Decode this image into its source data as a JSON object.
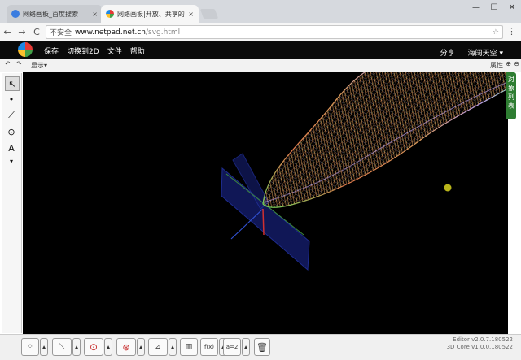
{
  "browser": {
    "tabs": [
      {
        "title": "网络画板_百度搜索",
        "close": "×"
      },
      {
        "title": "网络画板|开放、共享的",
        "close": "×"
      }
    ],
    "window_controls": {
      "minimize": "—",
      "maximize": "☐",
      "close": "✕"
    },
    "back": "←",
    "forward": "→",
    "reload": "C",
    "security_text": "不安全",
    "url_host": "www.netpad.net.cn",
    "url_path": "/svg.html",
    "star": "☆",
    "menu": "⋮"
  },
  "app": {
    "menu": [
      "保存",
      "切换到2D",
      "文件",
      "帮助"
    ],
    "share": "分享",
    "user": "海阔天空 ▾"
  },
  "toolbar": {
    "undo": "↶",
    "redo": "↷",
    "show_label": "显示▾",
    "props_label": "属性",
    "zoom_in": "⊕",
    "zoom_out": "⊖"
  },
  "sidebar_tools": [
    {
      "name": "select-tool",
      "glyph": "↖"
    },
    {
      "name": "point-tool",
      "glyph": "•"
    },
    {
      "name": "segment-tool",
      "glyph": "⟋"
    },
    {
      "name": "circle-tool",
      "glyph": "⊙"
    },
    {
      "name": "text-tool",
      "glyph": "A"
    },
    {
      "name": "more-tools",
      "glyph": "▾"
    }
  ],
  "object_list_label": "对象列表",
  "bottom_tools": [
    {
      "name": "points-group",
      "glyph": "⁘"
    },
    {
      "name": "lines-group",
      "glyph": "⟍"
    },
    {
      "name": "circles-group",
      "glyph": "⊙"
    },
    {
      "name": "transform-group",
      "glyph": "⊛"
    },
    {
      "name": "construct-group",
      "glyph": "⊿"
    },
    {
      "name": "solid-group",
      "glyph": "▥"
    },
    {
      "name": "function-group",
      "glyph": "f(x)"
    },
    {
      "name": "formula-group",
      "glyph": "a=2"
    },
    {
      "name": "delete-tool",
      "glyph": "🗑"
    }
  ],
  "version": {
    "editor": "Editor v2.0.7.180522",
    "core": "3D Core v1.0.0.180522"
  },
  "colors": {
    "canvas": "#000000",
    "appbar": "#0a0a0a",
    "objlist": "#2e7d32",
    "plane": "#1b2a8a",
    "point": "#b9b51a"
  }
}
